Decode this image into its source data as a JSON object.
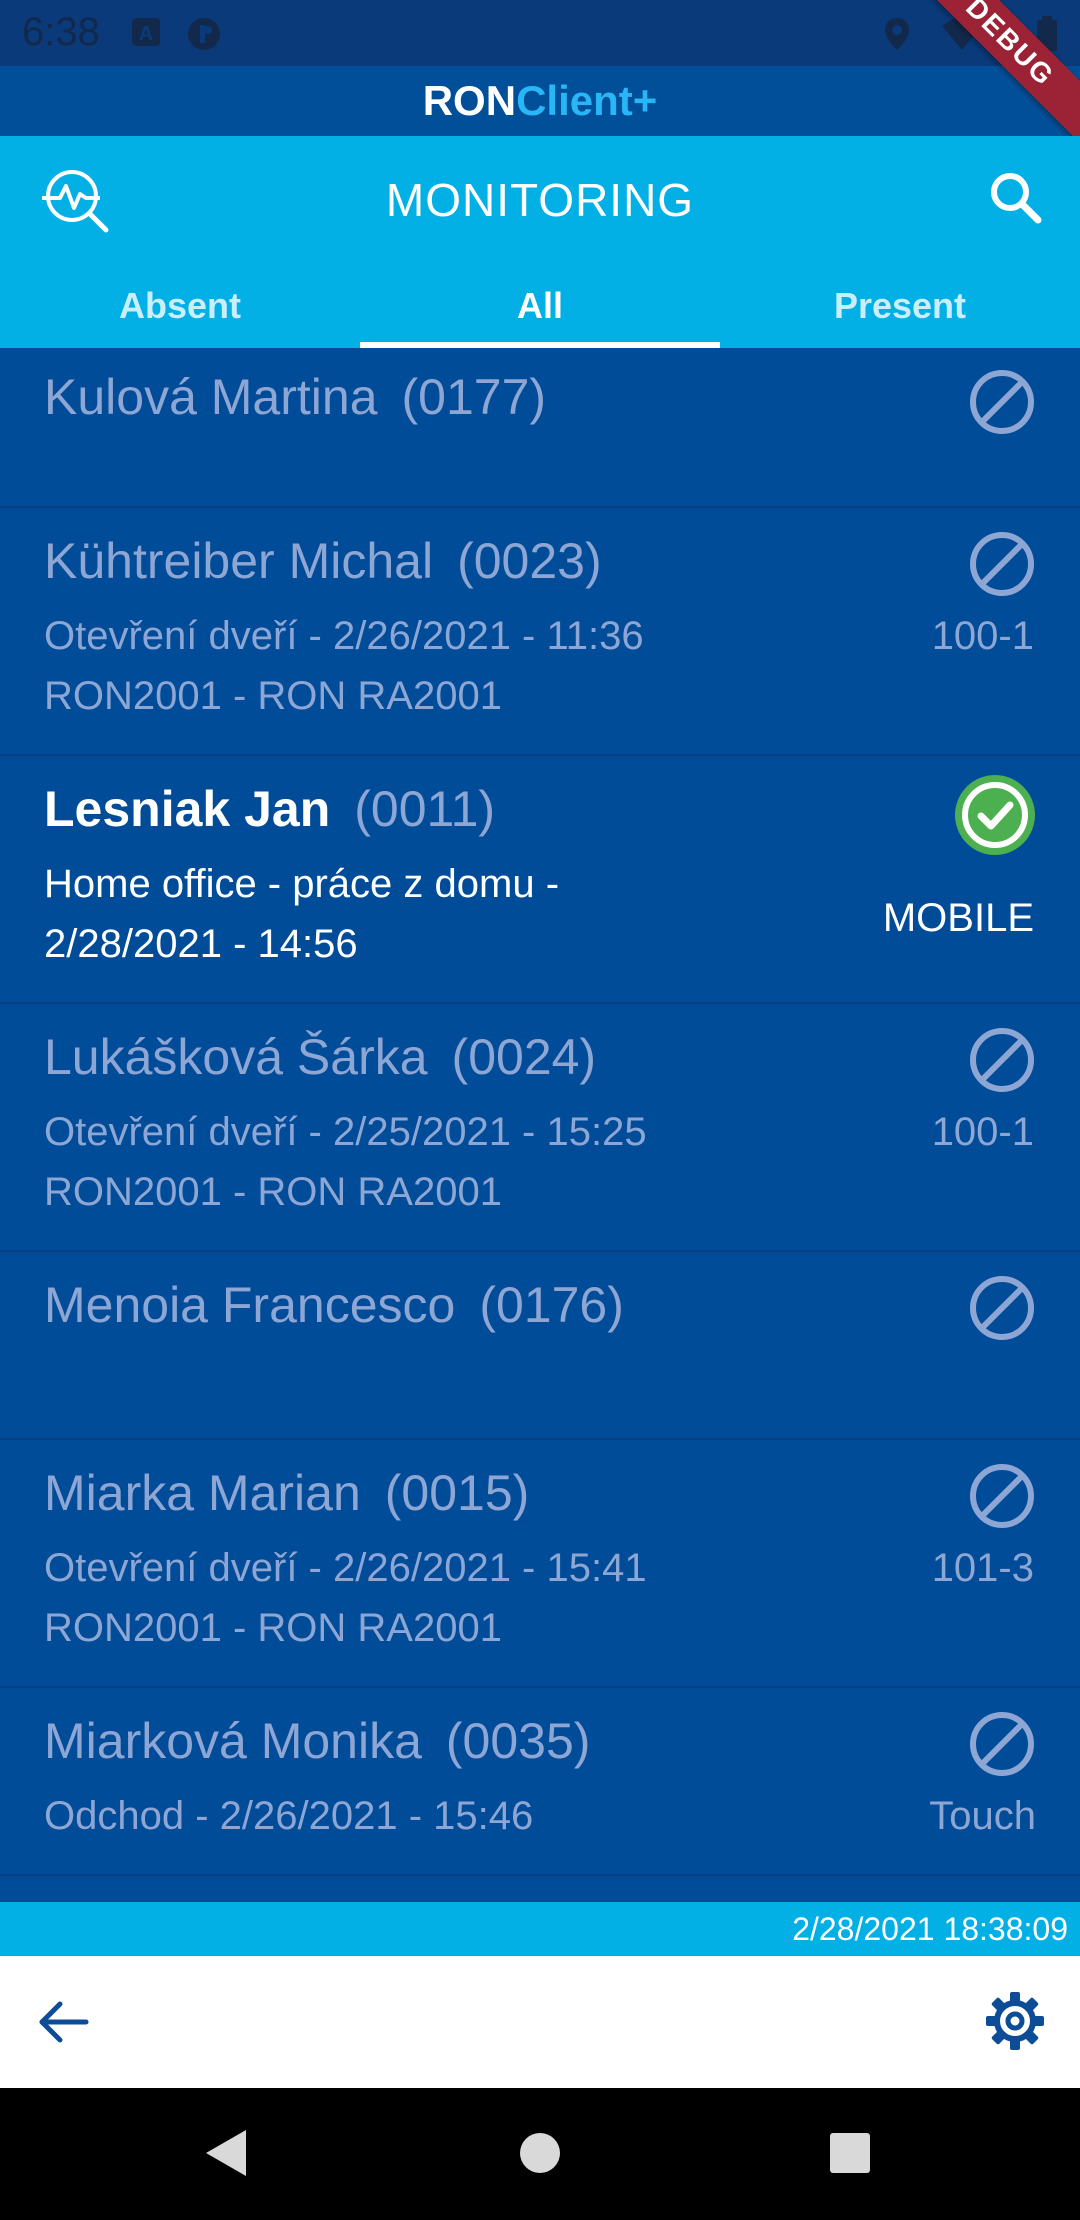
{
  "status_bar": {
    "time": "6:38"
  },
  "debug_banner": "DEBUG",
  "brand": {
    "ron": "RON",
    "client": "Client+"
  },
  "app_bar": {
    "title": "MONITORING",
    "left_icon": "monitoring-search-icon",
    "right_icon": "search-icon"
  },
  "tabs": [
    {
      "label": "Absent"
    },
    {
      "label": "All"
    },
    {
      "label": "Present"
    }
  ],
  "active_tab": "All",
  "employees": [
    {
      "name": "Kulová Martina",
      "code": "(0177)",
      "line1": "",
      "line2": "",
      "status": "absent",
      "right_label": ""
    },
    {
      "name": "Kühtreiber Michal",
      "code": "(0023)",
      "line1": "Otevření dveří - 2/26/2021 - 11:36",
      "line2": "RON2001 - RON RA2001",
      "status": "absent",
      "right_label": "100-1"
    },
    {
      "name": "Lesniak Jan",
      "code": "(0011)",
      "line1": "Home office - práce z domu -",
      "line2": "2/28/2021 - 14:56",
      "status": "present",
      "right_label": "MOBILE"
    },
    {
      "name": "Lukášková Šárka",
      "code": "(0024)",
      "line1": "Otevření dveří - 2/25/2021 - 15:25",
      "line2": "RON2001 - RON RA2001",
      "status": "absent",
      "right_label": "100-1"
    },
    {
      "name": "Menoia Francesco",
      "code": "(0176)",
      "line1": "",
      "line2": "",
      "status": "absent",
      "right_label": ""
    },
    {
      "name": "Miarka Marian",
      "code": "(0015)",
      "line1": "Otevření dveří - 2/26/2021 - 15:41",
      "line2": "RON2001 - RON RA2001",
      "status": "absent",
      "right_label": "101-3"
    },
    {
      "name": "Miarková Monika",
      "code": "(0035)",
      "line1": "Odchod - 2/26/2021 - 15:46",
      "line2": "",
      "status": "absent",
      "right_label": "Touch"
    }
  ],
  "footer": {
    "timestamp": "2/28/2021 18:38:09"
  },
  "colors": {
    "primary_dark": "#004c98",
    "accent": "#03b0e6",
    "present_green": "#4caf50"
  }
}
